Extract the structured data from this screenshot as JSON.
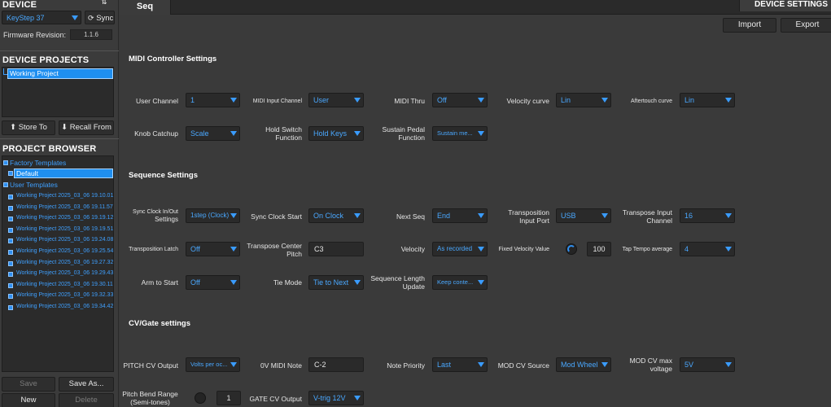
{
  "device": {
    "title": "DEVICE",
    "device_select": "KeyStep 37",
    "sync_label": "Sync",
    "firmware_label": "Firmware Revision:",
    "firmware_value": "1.1.6"
  },
  "projects": {
    "title": "DEVICE PROJECTS",
    "items": [
      "Working Project"
    ],
    "store_label": "Store To",
    "recall_label": "Recall From"
  },
  "browser": {
    "title": "PROJECT BROWSER",
    "factory_label": "Factory Templates",
    "default_label": "Default",
    "user_label": "User Templates",
    "user_items": [
      "Working Project 2025_03_06 19.10.01",
      "Working Project 2025_03_06 19.11.57",
      "Working Project 2025_03_06 19.19.12",
      "Working Project 2025_03_06 19.19.51",
      "Working Project 2025_03_06 19.24.08",
      "Working Project 2025_03_06 19.25.54",
      "Working Project 2025_03_06 19.27.32",
      "Working Project 2025_03_06 19.29.43",
      "Working Project 2025_03_06 19.30.11",
      "Working Project 2025_03_06 19.32.33",
      "Working Project 2025_03_06 19.34.42"
    ],
    "save_label": "Save",
    "save_as_label": "Save As...",
    "new_label": "New",
    "delete_label": "Delete"
  },
  "tabs": {
    "seq": "Seq",
    "device_settings": "DEVICE SETTINGS"
  },
  "toolbar": {
    "import": "Import",
    "export": "Export"
  },
  "midi": {
    "title": "MIDI Controller Settings",
    "user_channel": {
      "label": "User Channel",
      "value": "1"
    },
    "midi_input_channel": {
      "label": "MIDI Input Channel",
      "value": "User"
    },
    "midi_thru": {
      "label": "MIDI Thru",
      "value": "Off"
    },
    "velocity_curve": {
      "label": "Velocity curve",
      "value": "Lin"
    },
    "aftertouch_curve": {
      "label": "Aftertouch curve",
      "value": "Lin"
    },
    "knob_catchup": {
      "label": "Knob Catchup",
      "value": "Scale"
    },
    "hold_switch": {
      "label1": "Hold Switch",
      "label2": "Function",
      "value": "Hold Keys"
    },
    "sustain_pedal": {
      "label1": "Sustain Pedal",
      "label2": "Function",
      "value": "Sustain me..."
    }
  },
  "sequence": {
    "title": "Sequence Settings",
    "sync_clock": {
      "label1": "Sync Clock In/Out",
      "label2": "Settings",
      "value": "1step (Clock)"
    },
    "sync_clock_start": {
      "label": "Sync Clock Start",
      "value": "On Clock"
    },
    "next_seq": {
      "label": "Next Seq",
      "value": "End"
    },
    "transposition_input": {
      "label1": "Transposition",
      "label2": "Input Port",
      "value": "USB"
    },
    "transpose_input_channel": {
      "label1": "Transpose Input",
      "label2": "Channel",
      "value": "16"
    },
    "transposition_latch": {
      "label": "Transposition Latch",
      "value": "Off"
    },
    "transpose_center": {
      "label1": "Transpose Center",
      "label2": "Pitch",
      "value": "C3"
    },
    "velocity": {
      "label": "Velocity",
      "value": "As recorded"
    },
    "fixed_velocity": {
      "label": "Fixed Velocity Value",
      "value": "100"
    },
    "tap_tempo": {
      "label": "Tap Tempo average",
      "value": "4"
    },
    "arm_to_start": {
      "label": "Arm to Start",
      "value": "Off"
    },
    "tie_mode": {
      "label": "Tie Mode",
      "value": "Tie to Next"
    },
    "seq_length_update": {
      "label1": "Sequence Length",
      "label2": "Update",
      "value": "Keep conte..."
    }
  },
  "cvgate": {
    "title": "CV/Gate settings",
    "pitch_cv_output": {
      "label": "PITCH CV Output",
      "value": "Volts per oc..."
    },
    "ov_midi_note": {
      "label": "0V MIDI Note",
      "value": "C-2"
    },
    "note_priority": {
      "label": "Note Priority",
      "value": "Last"
    },
    "mod_cv_source": {
      "label": "MOD CV Source",
      "value": "Mod Wheel"
    },
    "mod_cv_max": {
      "label1": "MOD CV max",
      "label2": "voltage",
      "value": "5V"
    },
    "pitch_bend_range": {
      "label1": "Pitch Bend Range",
      "label2": "(Semi-tones)",
      "value": "1"
    },
    "gate_cv_output": {
      "label": "GATE CV Output",
      "value": "V-trig 12V"
    }
  }
}
